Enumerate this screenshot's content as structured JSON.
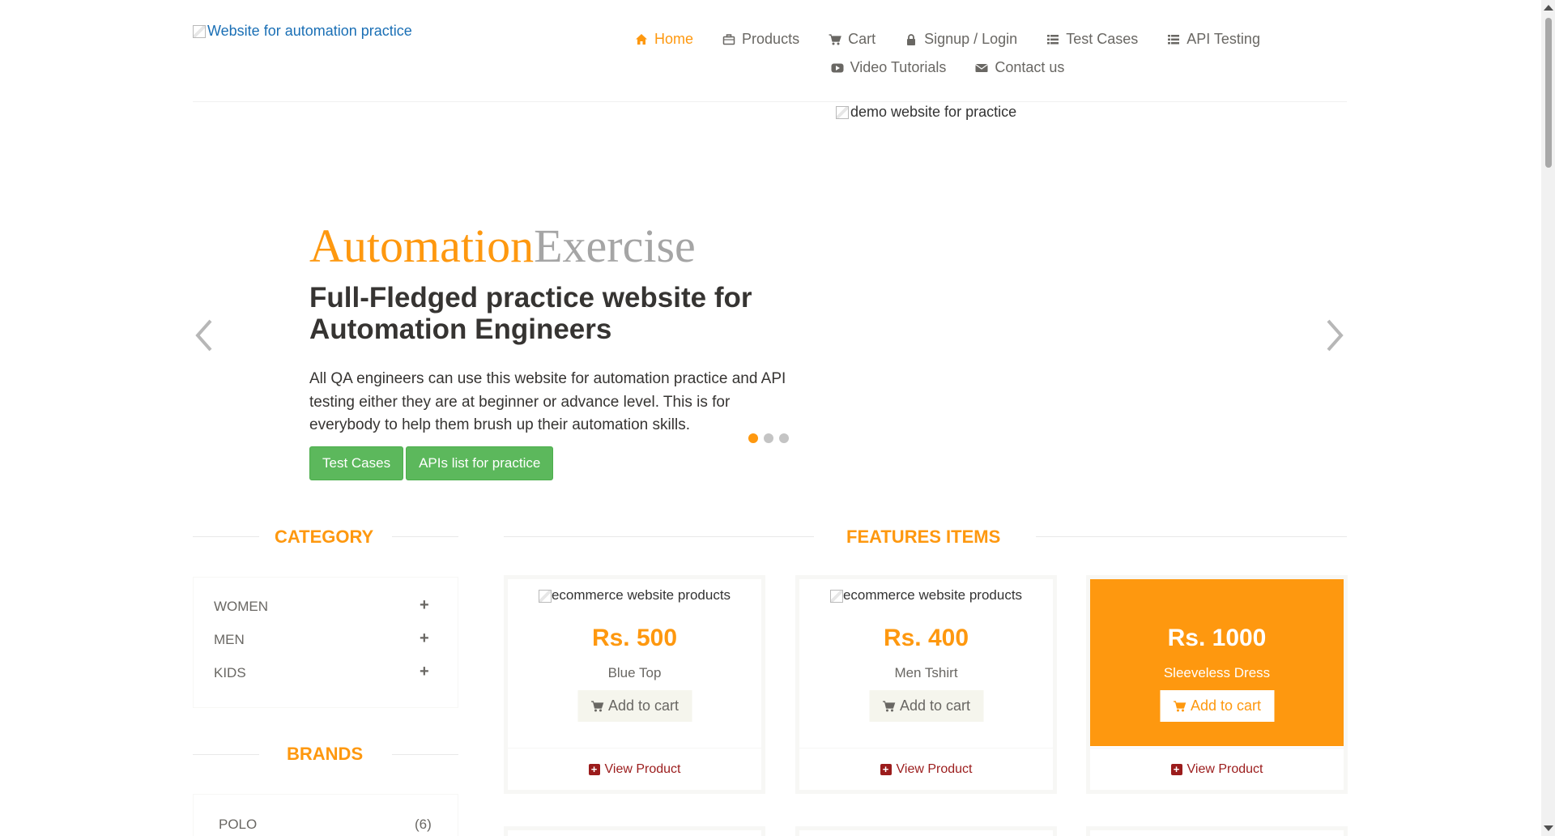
{
  "header": {
    "logo_alt": "Website for automation practice",
    "nav": [
      {
        "label": "Home",
        "icon": "home-icon",
        "active": true
      },
      {
        "label": "Products",
        "icon": "briefcase-icon"
      },
      {
        "label": "Cart",
        "icon": "cart-icon"
      },
      {
        "label": "Signup / Login",
        "icon": "lock-icon"
      },
      {
        "label": "Test Cases",
        "icon": "list-icon"
      },
      {
        "label": "API Testing",
        "icon": "list-icon"
      },
      {
        "label": "Video Tutorials",
        "icon": "youtube-icon"
      },
      {
        "label": "Contact us",
        "icon": "envelope-icon"
      }
    ]
  },
  "slider": {
    "image_alt": "demo website for practice",
    "brand_part1": "Automation",
    "brand_part2": "Exercise",
    "title": "Full-Fledged practice website for Automation Engineers",
    "description": "All QA engineers can use this website for automation practice and API testing either they are at beginner or advance level. This is for everybody to help them brush up their automation skills.",
    "btn_test_cases": "Test Cases",
    "btn_apis": "APIs list for practice",
    "dots": 3,
    "active_dot": 0
  },
  "sidebar": {
    "category_title": "Category",
    "categories": [
      "Women",
      "Men",
      "Kids"
    ],
    "brands_title": "Brands",
    "brands": [
      {
        "name": "Polo",
        "count": "(6)"
      }
    ]
  },
  "features": {
    "title": "Features Items",
    "products": [
      {
        "image_alt": "ecommerce website products",
        "price": "Rs. 500",
        "name": "Blue Top",
        "add_label": "Add to cart",
        "view_label": "View Product"
      },
      {
        "image_alt": "ecommerce website products",
        "price": "Rs. 400",
        "name": "Men Tshirt",
        "add_label": "Add to cart",
        "view_label": "View Product"
      },
      {
        "image_alt": "ecommerce website products",
        "price": "Rs. 1000",
        "name": "Sleeveless Dress",
        "add_label": "Add to cart",
        "view_label": "View Product",
        "hovered": true
      }
    ]
  },
  "colors": {
    "accent": "#FE980F",
    "green": "#5CB85C",
    "text": "#696763"
  }
}
